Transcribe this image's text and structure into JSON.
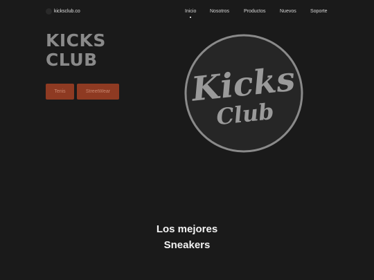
{
  "header": {
    "brand": "kicksclub.co",
    "nav": [
      {
        "label": "Inicio",
        "active": true
      },
      {
        "label": "Nosotros",
        "active": false
      },
      {
        "label": "Productos",
        "active": false
      },
      {
        "label": "Nuevos",
        "active": false
      },
      {
        "label": "Soporte",
        "active": false
      }
    ]
  },
  "hero": {
    "title_line1": "KICKS",
    "title_line2": "CLUB",
    "buttons": [
      {
        "label": "Tenis"
      },
      {
        "label": "StreetWear"
      }
    ],
    "logo": {
      "text_line1": "Kicks",
      "text_line2": "Club"
    }
  },
  "tagline": {
    "line1": "Los mejores",
    "line2": "Sneakers"
  },
  "colors": {
    "background": "#1a1a1a",
    "accent_button": "#8e3a22",
    "title_gray": "#8a8a8a"
  }
}
